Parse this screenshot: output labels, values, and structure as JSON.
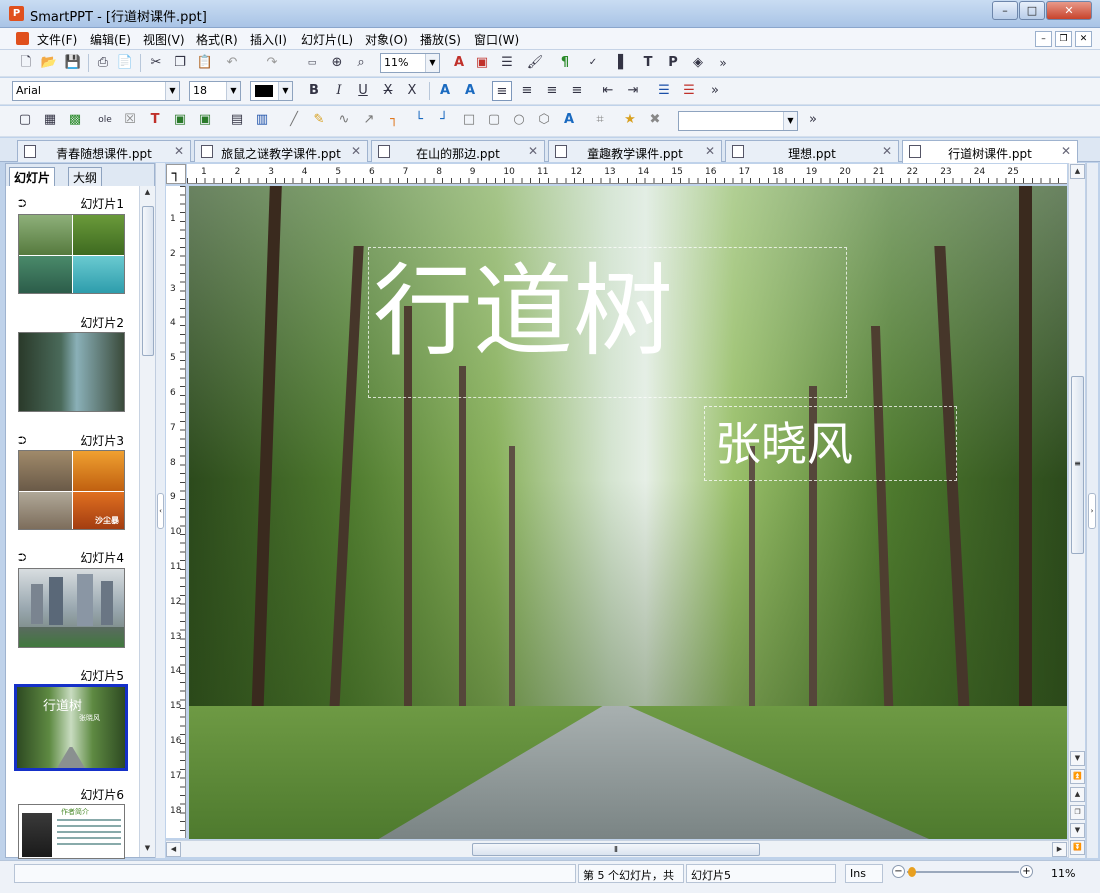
{
  "window": {
    "title": "SmartPPT - [行道树课件.ppt]",
    "app_icon_letter": "P"
  },
  "menu": [
    "文件(F)",
    "编辑(E)",
    "视图(V)",
    "格式(R)",
    "插入(I)",
    "幻灯片(L)",
    "对象(O)",
    "播放(S)",
    "窗口(W)"
  ],
  "toolbar": {
    "zoom": "11%",
    "font": "Arial",
    "font_size": "18",
    "more": "»"
  },
  "tabs": [
    {
      "label": "青春随想课件.ppt"
    },
    {
      "label": "旅鼠之谜教学课件.ppt"
    },
    {
      "label": "在山的那边.ppt"
    },
    {
      "label": "童趣教学课件.ppt"
    },
    {
      "label": "理想.ppt"
    },
    {
      "label": "行道树课件.ppt"
    }
  ],
  "panel_tabs": {
    "slides": "幻灯片",
    "outline": "大纲"
  },
  "slides": [
    {
      "label": "幻灯片1",
      "has_animation": true
    },
    {
      "label": "幻灯片2",
      "has_animation": false
    },
    {
      "label": "幻灯片3",
      "has_animation": true,
      "caption": "沙尘暴"
    },
    {
      "label": "幻灯片4",
      "has_animation": true
    },
    {
      "label": "幻灯片5",
      "has_animation": false,
      "title": "行道树",
      "author": "张晓风",
      "selected": true
    },
    {
      "label": "幻灯片6",
      "has_animation": false,
      "heading": "作者简介"
    }
  ],
  "slide": {
    "title": "行道树",
    "author": "张晓风"
  },
  "ruler_h": [
    "1",
    "2",
    "3",
    "4",
    "5",
    "6",
    "7",
    "8",
    "9",
    "10",
    "11",
    "12",
    "13",
    "14",
    "15",
    "16",
    "17",
    "18",
    "19",
    "20",
    "21",
    "22",
    "23",
    "24",
    "25"
  ],
  "ruler_v": [
    "1",
    "2",
    "3",
    "4",
    "5",
    "6",
    "7",
    "8",
    "9",
    "10",
    "11",
    "12",
    "13",
    "14",
    "15",
    "16",
    "17",
    "18"
  ],
  "status": {
    "slide_info": "第 5 个幻灯片，共",
    "slide_name": "幻灯片5",
    "mode": "Ins",
    "zoom": "11%"
  },
  "colors": {
    "selection": "#1530c8",
    "titlebar": "#bfd4ee",
    "accent_red": "#cc2a1a"
  }
}
